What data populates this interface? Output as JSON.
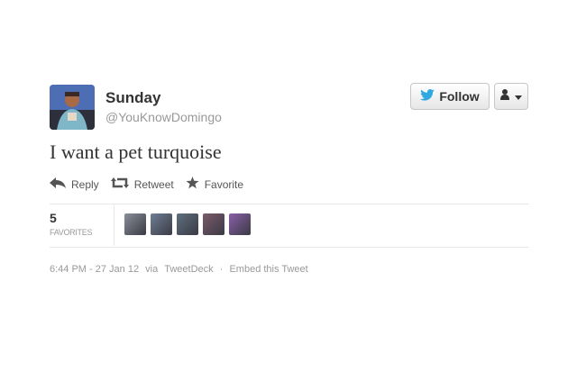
{
  "user": {
    "fullname": "Sunday",
    "username": "@YouKnowDomingo"
  },
  "buttons": {
    "follow_label": "Follow"
  },
  "tweet": {
    "text": "I want a pet turquoise"
  },
  "actions": [
    {
      "label": "Reply",
      "icon": "reply-icon"
    },
    {
      "label": "Retweet",
      "icon": "retweet-icon"
    },
    {
      "label": "Favorite",
      "icon": "star-icon"
    }
  ],
  "stats": {
    "favorites_count": "5",
    "favorites_label": "FAVORITES",
    "favoriters": [
      {
        "color": "#8a8f99"
      },
      {
        "color": "#6f7f95"
      },
      {
        "color": "#5f6f7c"
      },
      {
        "color": "#7a5a6a"
      },
      {
        "color": "#8a5fa8"
      }
    ]
  },
  "meta": {
    "timestamp": "6:44 PM - 27 Jan 12",
    "via_prefix": "via",
    "client": "TweetDeck",
    "separator": "·",
    "embed": "Embed this Tweet"
  },
  "colors": {
    "twitter_blue": "#2fa9e0",
    "text": "#333333",
    "muted": "#999999"
  }
}
